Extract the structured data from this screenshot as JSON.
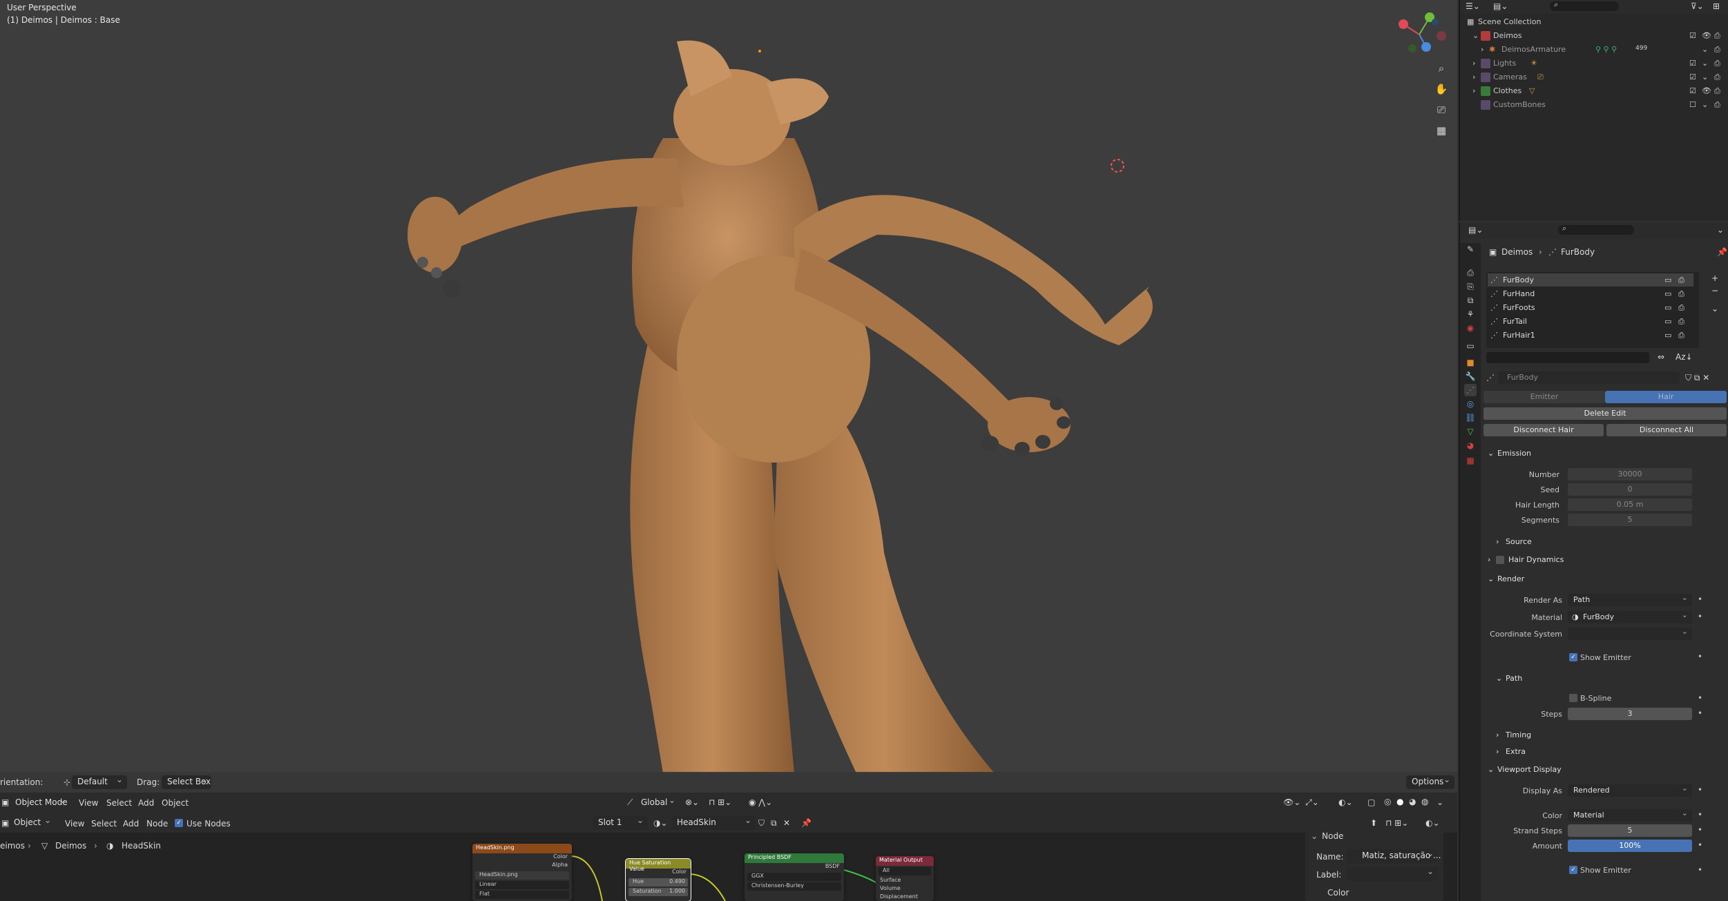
{
  "viewport": {
    "title": "User Perspective",
    "subtitle": "(1) Deimos | Deimos : Base"
  },
  "footer": {
    "orientation_label": "rientation:",
    "orientation_value": "Default",
    "drag_label": "Drag:",
    "drag_value": "Select Box",
    "options_label": "Options"
  },
  "vp_header": {
    "mode": "Object Mode",
    "menus": [
      "View",
      "Select",
      "Add",
      "Object"
    ],
    "transform_orientation": "Global"
  },
  "node_header": {
    "mode": "Object",
    "menus": [
      "View",
      "Select",
      "Add",
      "Node"
    ],
    "use_nodes_label": "Use Nodes",
    "slot": "Slot 1",
    "material": "HeadSkin",
    "breadcrumb": [
      "eimos",
      "Deimos",
      "HeadSkin"
    ]
  },
  "nodes": {
    "image": {
      "title": "HeadSkin.png",
      "outputs": [
        "Color",
        "Alpha"
      ],
      "file": "HeadSkin.png",
      "interp": "Linear",
      "proj": "Flat"
    },
    "hsv": {
      "title": "Hue Saturation Value",
      "out": "Color",
      "hue_label": "Hue",
      "hue_val": "0.490",
      "sat_label": "Saturation",
      "sat_val": "1.000"
    },
    "bsdf": {
      "title": "Principled BSDF",
      "out": "BSDF",
      "dist": "GGX",
      "sss": "Christensen-Burley"
    },
    "output": {
      "title": "Material Output",
      "target": "All",
      "sockets": [
        "Surface",
        "Volume",
        "Displacement"
      ]
    }
  },
  "node_sidebar": {
    "panel": "Node",
    "name_label": "Name:",
    "name_value": "Matiz, saturação ...",
    "label_label": "Label:",
    "color_label": "Color"
  },
  "outliner": {
    "root": "Scene Collection",
    "rows": [
      {
        "label": "Deimos",
        "color": "#e06060"
      },
      {
        "label": "DeimosArmature",
        "color": "#9a9a9a"
      },
      {
        "label": "Lights",
        "color": "#9a9a9a"
      },
      {
        "label": "Cameras",
        "color": "#9a9a9a"
      },
      {
        "label": "Clothes",
        "color": "#d8d8d8"
      },
      {
        "label": "CustomBones",
        "color": "#9a9a9a"
      }
    ],
    "badge": "499"
  },
  "properties": {
    "breadcrumb_obj": "Deimos",
    "breadcrumb_sys": "FurBody",
    "particle_systems": [
      "FurBody",
      "FurHand",
      "FurFoots",
      "FurTail",
      "FurHair1"
    ],
    "settings_name": "FurBody",
    "type_tabs": [
      "Emitter",
      "Hair"
    ],
    "delete_edit": "Delete Edit",
    "disconnect_hair": "Disconnect Hair",
    "disconnect_all": "Disconnect All",
    "emission": {
      "title": "Emission",
      "number_label": "Number",
      "number": "30000",
      "seed_label": "Seed",
      "seed": "0",
      "hair_length_label": "Hair Length",
      "hair_length": "0.05 m",
      "segments_label": "Segments",
      "segments": "5"
    },
    "source": "Source",
    "hair_dynamics": "Hair Dynamics",
    "render": {
      "title": "Render",
      "render_as_label": "Render As",
      "render_as": "Path",
      "material_label": "Material",
      "material": "FurBody",
      "coord_label": "Coordinate System",
      "show_emitter": "Show Emitter",
      "path": "Path",
      "bspline": "B-Spline",
      "steps_label": "Steps",
      "steps": "3",
      "timing": "Timing",
      "extra": "Extra"
    },
    "viewport_display": {
      "title": "Viewport Display",
      "display_as_label": "Display As",
      "display_as": "Rendered",
      "color_label": "Color",
      "color": "Material",
      "strand_steps_label": "Strand Steps",
      "strand_steps": "5",
      "amount_label": "Amount",
      "amount": "100%",
      "show_emitter": "Show Emitter"
    }
  },
  "colors": {
    "fur": "#b07d4e",
    "fur_dark": "#8a5e36",
    "accent": "#4772b3",
    "viewport_bg": "#3d3d3d"
  }
}
